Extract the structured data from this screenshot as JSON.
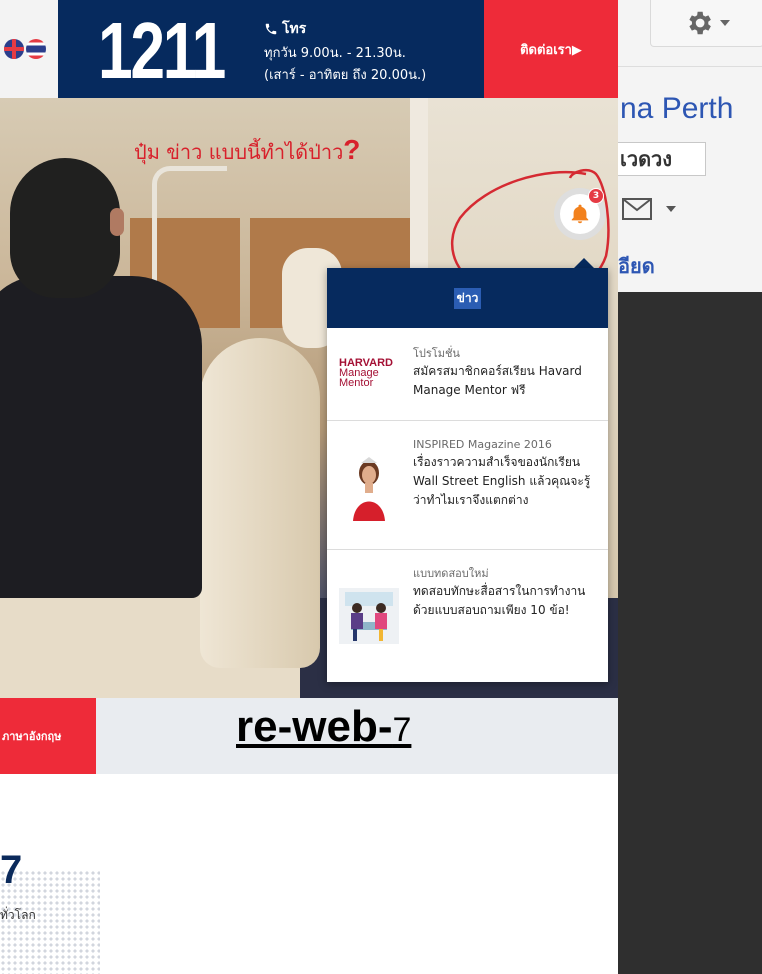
{
  "topbar": {
    "phone_number": "1211",
    "call_label": "โทร",
    "hours_line1": "ทุกวัน 9.00น. - 21.30น.",
    "hours_line2": "(เสาร์ - อาทิตย ถึง 20.00น.)",
    "contact_label": "ติดต่อเรา▶"
  },
  "hero": {
    "caption_text": "ปุ๋ม ข่าว แบบนี้ทำได้ป่าว",
    "caption_mark": "?"
  },
  "notifications": {
    "badge_count": "3",
    "header_title": "ข่าว",
    "items": [
      {
        "category": "โปรโมชั่น",
        "title": "สมัครสมาชิกคอร์สเรียน Havard Manage Mentor ฟรี",
        "logo_line1": "HARVARD",
        "logo_line2": "Manage",
        "logo_line3": "Mentor"
      },
      {
        "category": "INSPIRED Magazine 2016",
        "title": "เรื่องราวความสำเร็จของนักเรียน Wall Street English แล้วคุณจะรู้ว่าทำไมเราจึงแตกต่าง"
      },
      {
        "category": "แบบทดสอบใหม่",
        "title": "ทดสอบทักษะสื่อสารในการทำงาน ด้วยแบบสอบถามเพียง 10 ข้อ!"
      }
    ]
  },
  "strip": {
    "button_label": "ภาษาอังกฤษ",
    "label_main": "re-web-",
    "label_suffix": "7"
  },
  "stats": {
    "number": "7",
    "subtitle": "ทั่วโลก"
  },
  "sidepane": {
    "title": "na Perth",
    "subtitle": "เวดวง",
    "link": "อียด"
  },
  "colors": {
    "navy": "#062a5e",
    "red": "#ee2b39",
    "link_blue": "#2d56b3"
  }
}
